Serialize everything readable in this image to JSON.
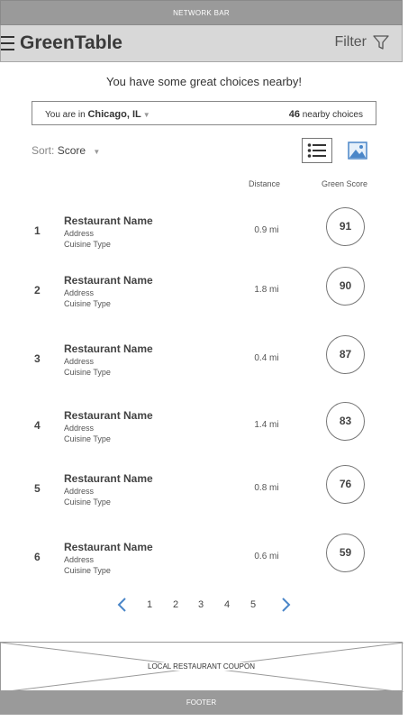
{
  "network_bar": {
    "label": "NETWORK BAR"
  },
  "header": {
    "app_title": "GreenTable",
    "filter_label": "Filter",
    "menu_icon": "hamburger-icon",
    "filter_icon": "funnel-icon"
  },
  "headline": "You have some great choices nearby!",
  "location": {
    "prefix": "You are in",
    "city": "Chicago, IL",
    "count": "46",
    "count_suffix": "nearby choices"
  },
  "sort": {
    "label": "Sort:",
    "value": "Score"
  },
  "view_toggle": {
    "list_icon": "list-view-icon",
    "image_icon": "image-view-icon"
  },
  "columns": {
    "distance": "Distance",
    "score": "Green Score"
  },
  "restaurants": [
    {
      "rank": "1",
      "name": "Restaurant Name",
      "address": "Address",
      "cuisine": "Cuisine Type",
      "distance": "0.9 mi",
      "score": "91"
    },
    {
      "rank": "2",
      "name": "Restaurant Name",
      "address": "Address",
      "cuisine": "Cuisine Type",
      "distance": "1.8 mi",
      "score": "90"
    },
    {
      "rank": "3",
      "name": "Restaurant Name",
      "address": "Address",
      "cuisine": "Cuisine Type",
      "distance": "0.4 mi",
      "score": "87"
    },
    {
      "rank": "4",
      "name": "Restaurant Name",
      "address": "Address",
      "cuisine": "Cuisine Type",
      "distance": "1.4 mi",
      "score": "83"
    },
    {
      "rank": "5",
      "name": "Restaurant Name",
      "address": "Address",
      "cuisine": "Cuisine Type",
      "distance": "0.8 mi",
      "score": "76"
    },
    {
      "rank": "6",
      "name": "Restaurant Name",
      "address": "Address",
      "cuisine": "Cuisine Type",
      "distance": "0.6 mi",
      "score": "59"
    }
  ],
  "pagination": {
    "pages": [
      "1",
      "2",
      "3",
      "4",
      "5"
    ],
    "prev_icon": "chevron-left-icon",
    "next_icon": "chevron-right-icon"
  },
  "ad": {
    "label": "LOCAL RESTAURANT COUPON"
  },
  "footer": {
    "label": "FOOTER"
  },
  "colors": {
    "accent": "#4a86c8",
    "bar": "#9a9a9a",
    "header_bg": "#d8d8d8"
  }
}
